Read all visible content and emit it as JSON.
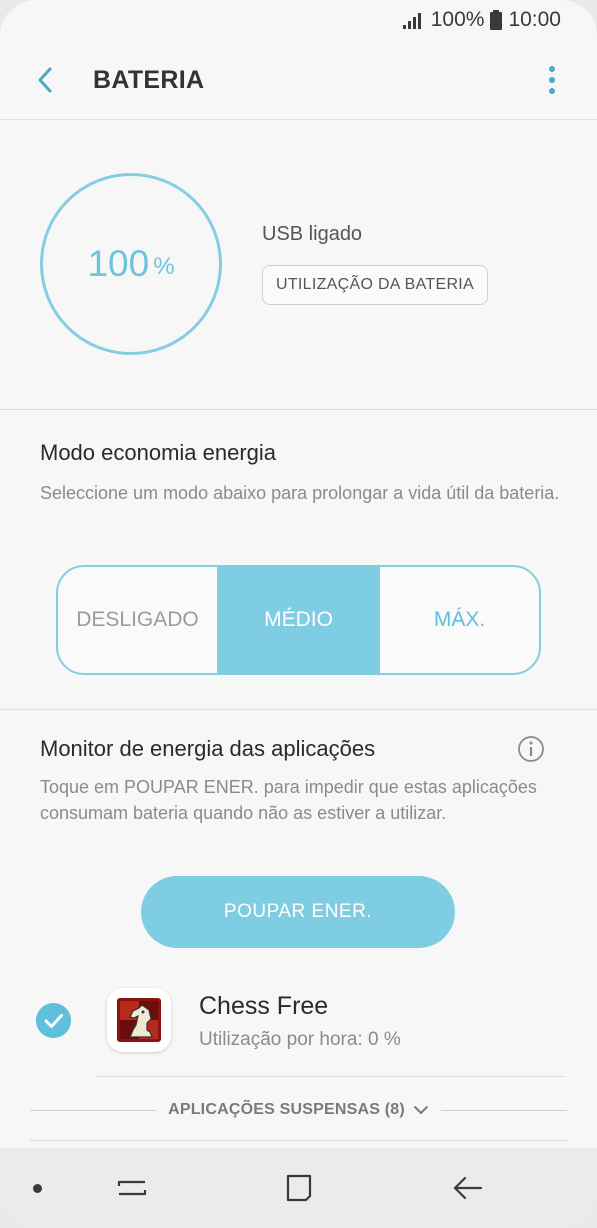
{
  "status_bar": {
    "battery_percent": "100%",
    "time": "10:00"
  },
  "app_bar": {
    "title": "BATERIA"
  },
  "battery": {
    "level_value": "100",
    "level_unit": "%",
    "status_text": "USB ligado",
    "usage_button": "UTILIZAÇÃO DA BATERIA"
  },
  "power_saving": {
    "title": "Modo economia energia",
    "description": "Seleccione um modo abaixo para prolongar a vida útil da bateria.",
    "modes": [
      "DESLIGADO",
      "MÉDIO",
      "MÁX."
    ],
    "selected": "MÉDIO"
  },
  "app_monitor": {
    "title": "Monitor de energia das aplicações",
    "description": "Toque em POUPAR ENER. para impedir que estas aplicações consumam bateria quando não as estiver a utilizar.",
    "save_button": "POUPAR ENER.",
    "apps": [
      {
        "name": "Chess Free",
        "usage": "Utilização por hora: 0 %",
        "checked": true
      }
    ],
    "suspended_label": "APLICAÇÕES SUSPENSAS (8)"
  },
  "colors": {
    "accent": "#7ecde3",
    "accent_dark": "#5ec0db"
  }
}
